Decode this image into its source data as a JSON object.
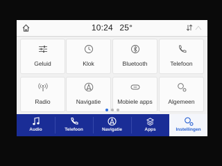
{
  "status": {
    "time": "10:24",
    "temperature": "25°"
  },
  "tiles": [
    {
      "label": "Geluid",
      "icon": "equalizer-icon"
    },
    {
      "label": "Klok",
      "icon": "clock-icon"
    },
    {
      "label": "Bluetooth",
      "icon": "bluetooth-icon"
    },
    {
      "label": "Telefoon",
      "icon": "phone-icon"
    },
    {
      "label": "Radio",
      "icon": "radio-antenna-icon"
    },
    {
      "label": "Navigatie",
      "icon": "navigation-icon"
    },
    {
      "label": "Mobiele apps",
      "icon": "mobile-apps-icon"
    },
    {
      "label": "Algemeen",
      "icon": "general-settings-icon"
    }
  ],
  "pager": {
    "pages": 3,
    "current": 1
  },
  "bottom_nav": [
    {
      "label": "Audio",
      "icon": "music-note-icon"
    },
    {
      "label": "Telefoon",
      "icon": "phone-icon"
    },
    {
      "label": "Navigatie",
      "icon": "navigation-icon"
    },
    {
      "label": "Apps",
      "icon": "apps-icon"
    },
    {
      "label": "Instellingen",
      "icon": "settings-icon",
      "active": true
    }
  ],
  "colors": {
    "accent": "#2d6fe0",
    "nav_bar": "#1a2d96",
    "active_tab_text": "#2a62d1"
  }
}
